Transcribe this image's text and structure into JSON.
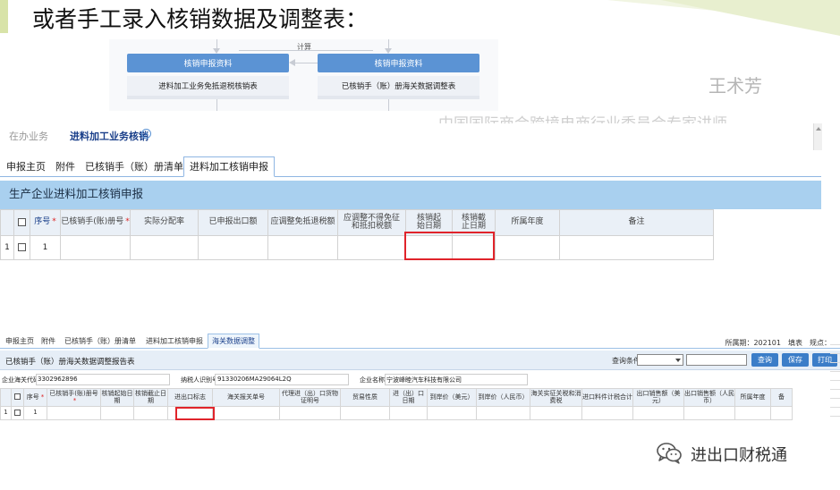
{
  "slide": {
    "title": "或者手工录入核销数据及调整表："
  },
  "flow": {
    "left_header": "核销申报资料",
    "left_item": "进料加工业务免抵退税核销表",
    "right_header": "核销申报资料",
    "right_item": "已核销手（账）册海关数据调整表",
    "arrow_label": "计算"
  },
  "watermark": {
    "name": "王术芳",
    "org": "中国国际商会跨境电商行业委员会专家讲师"
  },
  "app1": {
    "nav_tabs": [
      "在办业务",
      "进料加工业务核销"
    ],
    "close_glyph": "×",
    "sub_tabs": [
      "申报主页",
      "附件",
      "已核销手（账）册清单",
      "进料加工核销申报"
    ],
    "panel_title": "生产企业进料加工核销申报",
    "columns": [
      "序号",
      "已核销手(账)册号",
      "实际分配率",
      "已申报出口额",
      "应调整免抵退税额",
      "应调整不得免征和抵扣税额",
      "核销起始日期",
      "核销截止日期",
      "所属年度",
      "备注"
    ],
    "required_mark": "*",
    "row": {
      "row_num": "1",
      "seq": "1"
    }
  },
  "app2": {
    "tabs": [
      "申报主页",
      "附件",
      "已核销手（账）册清单",
      "进料加工核销申报",
      "海关数据调整"
    ],
    "period_label": "所属期：202101　填表　规点：",
    "title": "已核销手（账）册海关数据调整报告表",
    "query_label": "查询条件",
    "buttons": {
      "query": "查询",
      "save": "保存",
      "print": "打印"
    },
    "info": {
      "customs_label": "企业海关代码",
      "customs_value": "3302962896",
      "tax_label": "纳税人识别号",
      "tax_value": "91330206MA29064L2Q",
      "name_label": "企业名称",
      "name_value": "宁波峰睦汽车科技有限公司"
    },
    "columns": [
      "序号",
      "已核销手(账)册号",
      "核销起始日期",
      "核销截止日期",
      "进出口标志",
      "海关报关单号",
      "代理进（出）口货物证明号",
      "贸易性质",
      "进（出）口日期",
      "到岸价（美元）",
      "到岸价（人民币）",
      "海关实征关税和消费税",
      "进口料件计税合计",
      "出口销售额（美元）",
      "出口销售额（人民币）",
      "所属年度",
      "备"
    ],
    "required_mark": "*",
    "row": {
      "row_num": "1",
      "seq": "1"
    }
  },
  "footer": {
    "brand": "进出口财税通",
    "icon": "wechat-icon"
  },
  "colors": {
    "panel_blue": "#a9d0ef",
    "flow_blue": "#5b93d4",
    "highlight_red": "#e0242b",
    "button_blue": "#3b7dc8"
  }
}
